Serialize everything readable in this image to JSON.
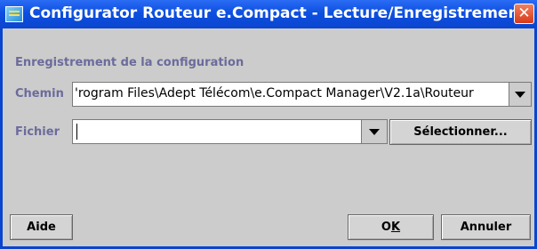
{
  "window": {
    "title": "Configurator Routeur e.Compact - Lecture/Enregistrement",
    "app_icon": "app-icon",
    "close_label": "✕"
  },
  "section": {
    "title": "Enregistrement de la configuration"
  },
  "chemin": {
    "label": "Chemin",
    "value": "'rogram Files\\Adept Télécom\\e.Compact Manager\\V2.1a\\Routeur"
  },
  "fichier": {
    "label": "Fichier",
    "value": ""
  },
  "buttons": {
    "select": "Sélectionner...",
    "aide": "Aide",
    "ok_prefix": "O",
    "ok_mnemonic": "K",
    "annuler": "Annuler"
  },
  "colors": {
    "title_bar": "#0d4fe0",
    "label_text": "#6b6b9c",
    "window_bg": "#cccccc"
  }
}
